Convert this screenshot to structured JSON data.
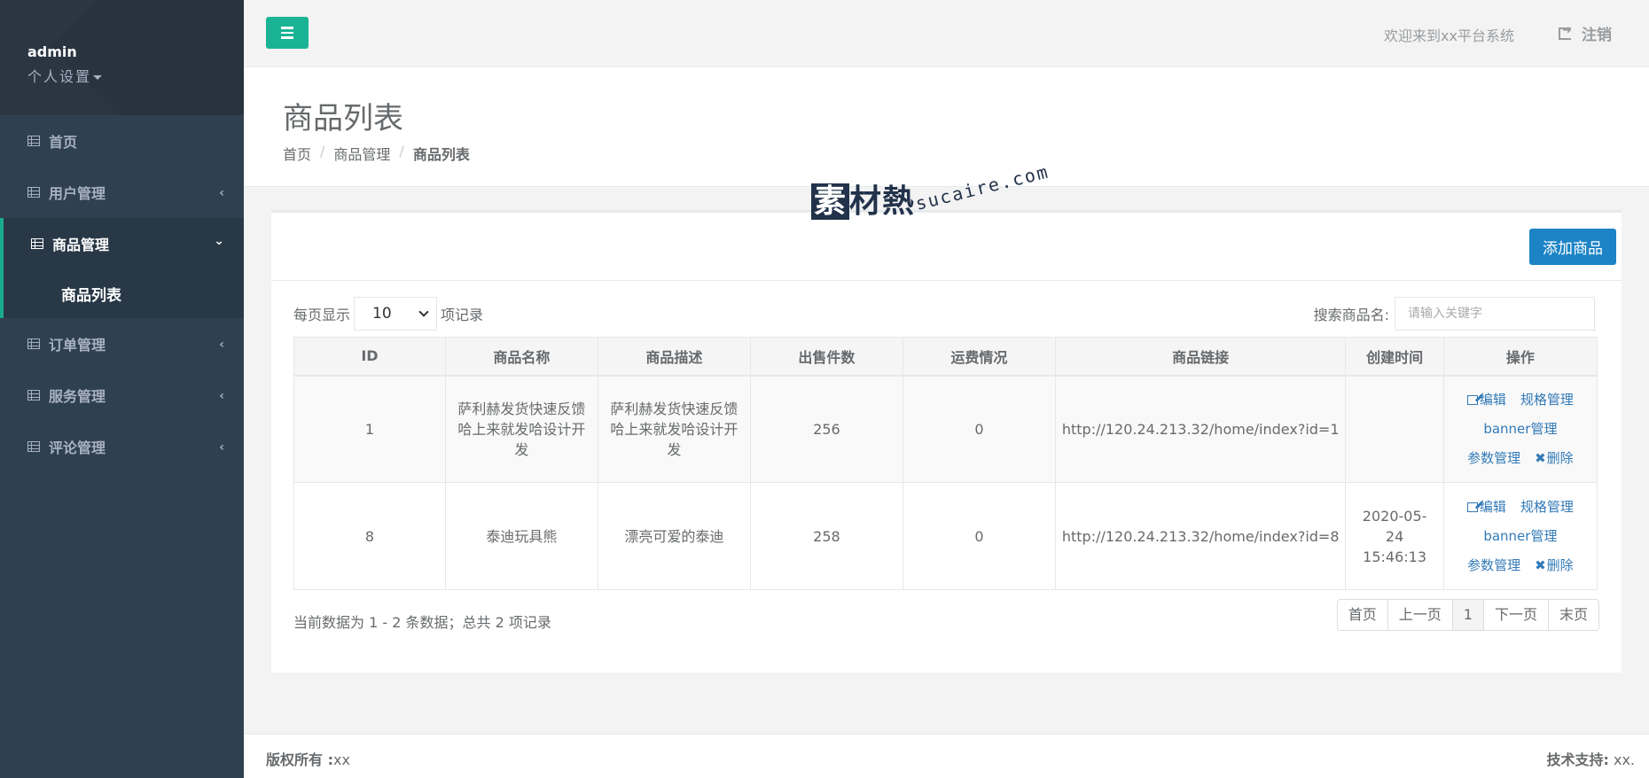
{
  "sidebar": {
    "user": {
      "name": "admin",
      "settings_label": "个人设置"
    },
    "items": [
      {
        "label": "首页",
        "icon": "table-icon",
        "arrow": ""
      },
      {
        "label": "用户管理",
        "icon": "table-icon",
        "arrow": "‹"
      },
      {
        "label": "商品管理",
        "icon": "table-icon",
        "arrow": "⌄"
      },
      {
        "label": "订单管理",
        "icon": "table-icon",
        "arrow": "‹"
      },
      {
        "label": "服务管理",
        "icon": "table-icon",
        "arrow": "‹"
      },
      {
        "label": "评论管理",
        "icon": "table-icon",
        "arrow": "‹"
      }
    ],
    "active_submenu": {
      "label": "商品列表"
    }
  },
  "topbar": {
    "welcome_text": "欢迎来到xx平台系统",
    "logout_label": "注销"
  },
  "heading": {
    "title": "商品列表",
    "breadcrumb": [
      "首页",
      "商品管理",
      "商品列表"
    ],
    "separator": "/"
  },
  "watermark": {
    "mark_first": "素",
    "mark_rest": "材熱",
    "url": "sucaire.com"
  },
  "panel": {
    "add_button_label": "添加商品",
    "per_page_prefix": "每页显示",
    "per_page_value": "10",
    "per_page_suffix": "项记录",
    "search_label": "搜索商品名:",
    "search_placeholder": "请输入关键字"
  },
  "table": {
    "columns": [
      "ID",
      "商品名称",
      "商品描述",
      "出售件数",
      "运费情况",
      "商品链接",
      "创建时间",
      "操作"
    ],
    "rows": [
      {
        "id": "1",
        "name": "萨利赫发货快速反馈哈上来就发哈设计开发",
        "desc": "萨利赫发货快速反馈哈上来就发哈设计开发",
        "sold": "256",
        "shipping": "0",
        "link": "http://120.24.213.32/home/index?id=1",
        "created": ""
      },
      {
        "id": "8",
        "name": "泰迪玩具熊",
        "desc": "漂亮可爱的泰迪",
        "sold": "258",
        "shipping": "0",
        "link": "http://120.24.213.32/home/index?id=8",
        "created": "2020-05-24 15:46:13"
      }
    ],
    "actions": {
      "edit": "编辑",
      "spec": "规格管理",
      "banner": "banner管理",
      "params": "参数管理",
      "delete": "删除"
    }
  },
  "pagination": {
    "info": "当前数据为 1 - 2 条数据；总共 2 项记录",
    "first": "首页",
    "prev": "上一页",
    "current": "1",
    "next": "下一页",
    "last": "末页"
  },
  "footer": {
    "copyright_label": "版权所有 :",
    "copyright_value": "xx",
    "support_label": "技术支持:",
    "support_value": " xx."
  },
  "colors": {
    "sidebar_bg": "#2f4050",
    "accent_green": "#1ab394",
    "primary_blue": "#1c84c6",
    "link_blue": "#337ab7"
  }
}
